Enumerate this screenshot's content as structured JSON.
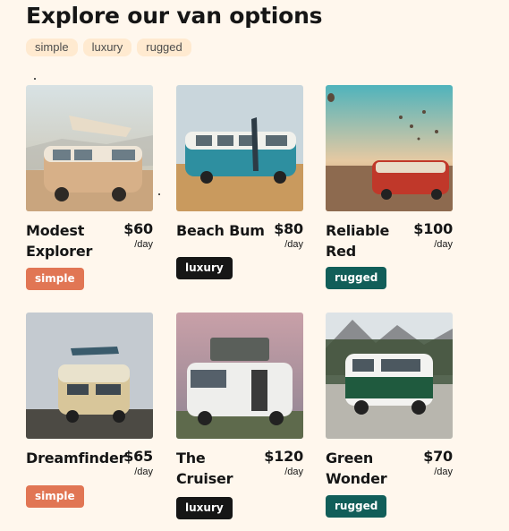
{
  "page_title": "Explore our van options",
  "filters": [
    "simple",
    "luxury",
    "rugged"
  ],
  "vans": [
    {
      "name": "Modest Explorer",
      "price": "$60",
      "per": "/day",
      "type": "simple",
      "image": "tan-van-with-popup-roof"
    },
    {
      "name": "Beach Bum",
      "price": "$80",
      "per": "/day",
      "type": "luxury",
      "image": "teal-white-van-on-beach"
    },
    {
      "name": "Reliable Red",
      "price": "$100",
      "per": "/day",
      "type": "rugged",
      "image": "red-van-with-balloons"
    },
    {
      "name": "Dreamfinder",
      "price": "$65",
      "per": "/day",
      "type": "simple",
      "image": "cream-van-with-surfboard"
    },
    {
      "name": "The Cruiser",
      "price": "$120",
      "per": "/day",
      "type": "luxury",
      "image": "white-van-with-rooftop-tent"
    },
    {
      "name": "Green Wonder",
      "price": "$70",
      "per": "/day",
      "type": "rugged",
      "image": "green-white-van-in-mountains"
    }
  ],
  "colors": {
    "background": "#FFF7ED",
    "chip": "#FFEAD0",
    "simple": "#E17654",
    "luxury": "#161616",
    "rugged": "#115E59"
  }
}
